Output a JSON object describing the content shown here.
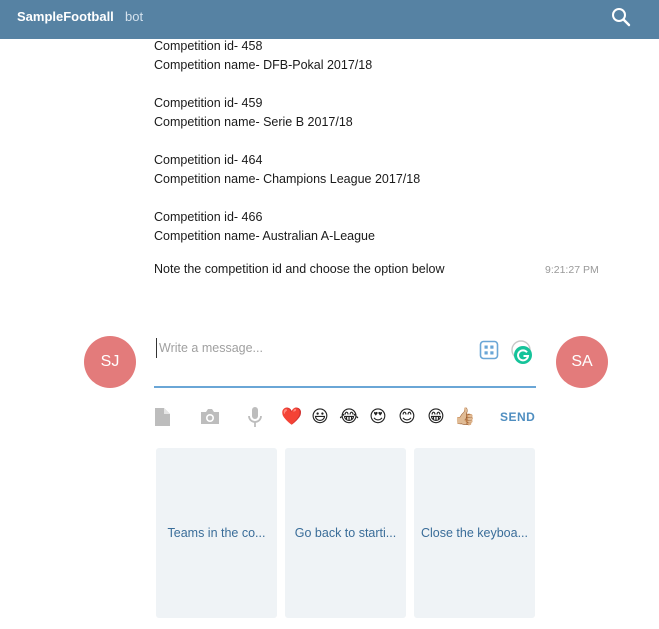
{
  "header": {
    "title": "SampleFootball",
    "subtitle": "bot"
  },
  "messages": {
    "lines": [
      "Competition id- 458",
      "Competition name- DFB-Pokal 2017/18",
      "Competition id- 459",
      "Competition name- Serie B 2017/18",
      "Competition id- 464",
      "Competition name- Champions League 2017/18",
      "Competition id- 466",
      "Competition name- Australian A-League",
      "Note the competition id and choose the option below"
    ],
    "time": "9:21:27 PM"
  },
  "avatars": {
    "left": "SJ",
    "right": "SA"
  },
  "composer": {
    "placeholder": "Write a message..."
  },
  "toolbar": {
    "emojis": [
      "❤️",
      "😃",
      "😂",
      "😍",
      "😊",
      "😁",
      "👍🏼"
    ],
    "send_label": "SEND"
  },
  "keyboard": {
    "buttons": [
      "Teams in the co...",
      "Go back to starti...",
      "Close the keyboa..."
    ]
  },
  "colors": {
    "header": "#5682a3",
    "avatar": "#e37b7b",
    "accent": "#4f8ec0",
    "keyboard_bg": "#eff3f6"
  }
}
